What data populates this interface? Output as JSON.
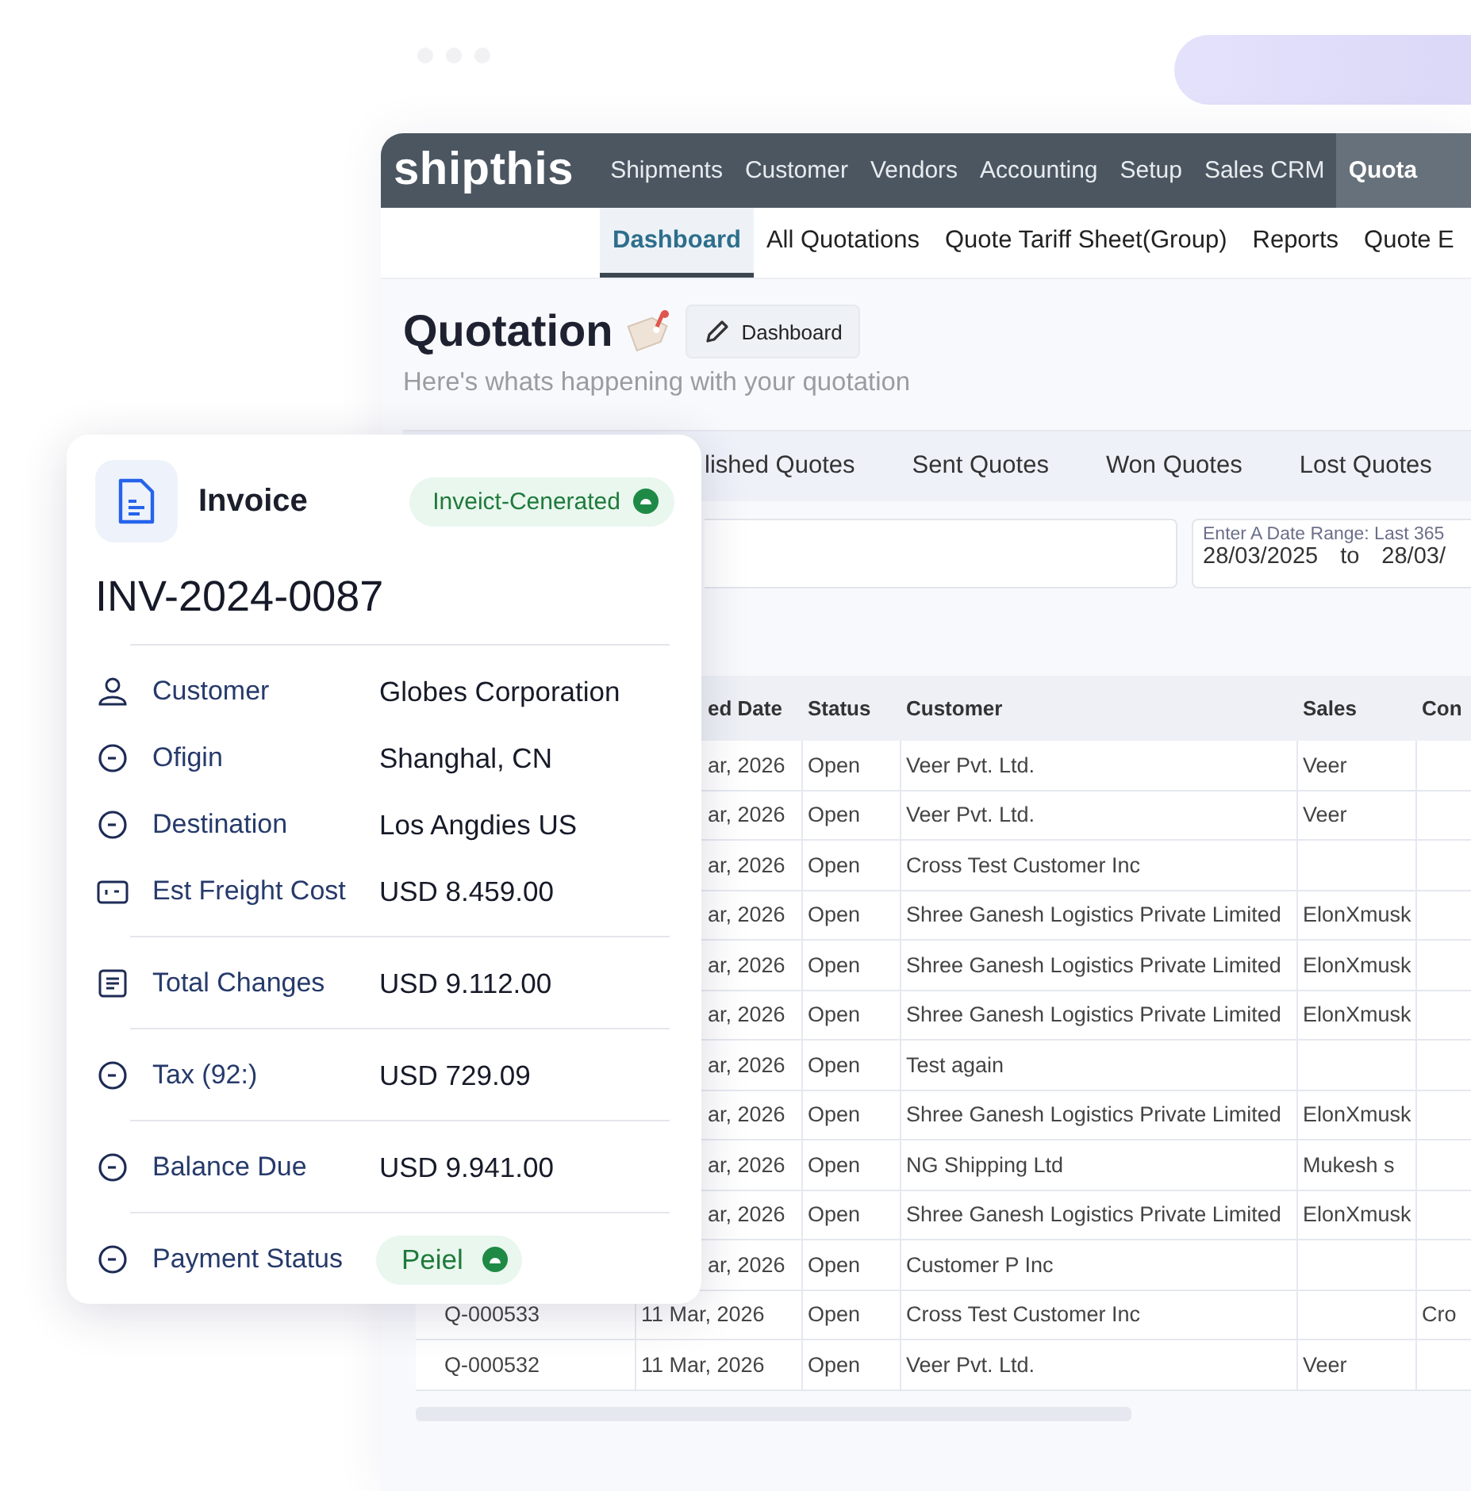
{
  "navbar": {
    "logo": "shipthis",
    "items": [
      {
        "label": "Shipments",
        "selected": false
      },
      {
        "label": "Customer",
        "selected": false
      },
      {
        "label": "Vendors",
        "selected": false
      },
      {
        "label": "Accounting",
        "selected": false
      },
      {
        "label": "Setup",
        "selected": false
      },
      {
        "label": "Sales CRM",
        "selected": false
      },
      {
        "label": "Quota",
        "selected": true
      }
    ]
  },
  "subnav": [
    {
      "label": "Dashboard",
      "selected": true
    },
    {
      "label": "All Quotations",
      "selected": false
    },
    {
      "label": "Quote Tariff Sheet(Group)",
      "selected": false
    },
    {
      "label": "Reports",
      "selected": false
    },
    {
      "label": "Quote E",
      "selected": false
    }
  ],
  "page": {
    "title": "Quotation",
    "button": "Dashboard",
    "subtitle": "Here's whats happening with your quotation"
  },
  "quote_tabs": [
    {
      "label": "lished Quotes",
      "selected": false
    },
    {
      "label": "Sent Quotes",
      "selected": false
    },
    {
      "label": "Won Quotes",
      "selected": false
    },
    {
      "label": "Lost Quotes",
      "selected": false
    }
  ],
  "filters": {
    "date_range": {
      "label": "Enter A Date Range: Last 365",
      "from": "28/03/2025",
      "separator": "to",
      "to": "28/03/"
    }
  },
  "table": {
    "columns": [
      "ed Date",
      "Status",
      "Customer",
      "Sales",
      "Con"
    ],
    "rows": [
      {
        "date": "ar, 2026",
        "status": "Open",
        "customer": "Veer Pvt. Ltd.",
        "sales": "Veer"
      },
      {
        "date": "ar, 2026",
        "status": "Open",
        "customer": "Veer Pvt. Ltd.",
        "sales": "Veer"
      },
      {
        "date": "ar, 2026",
        "status": "Open",
        "customer": "Cross Test Customer Inc"
      },
      {
        "date": "ar, 2026",
        "status": "Open",
        "customer": "Shree Ganesh Logistics Private Limited",
        "sales": "ElonXmusk"
      },
      {
        "date": "ar, 2026",
        "status": "Open",
        "customer": "Shree Ganesh Logistics Private Limited",
        "sales": "ElonXmusk"
      },
      {
        "date": "ar, 2026",
        "status": "Open",
        "customer": "Shree Ganesh Logistics Private Limited",
        "sales": "ElonXmusk"
      },
      {
        "date": "ar, 2026",
        "status": "Open",
        "customer": "Test again"
      },
      {
        "date": "ar, 2026",
        "status": "Open",
        "customer": "Shree Ganesh Logistics Private Limited",
        "sales": "ElonXmusk"
      },
      {
        "date": "ar, 2026",
        "status": "Open",
        "customer": "NG Shipping Ltd",
        "sales": "Mukesh s"
      },
      {
        "date": "ar, 2026",
        "status": "Open",
        "customer": "Shree Ganesh Logistics Private Limited",
        "sales": "ElonXmusk"
      },
      {
        "date": "ar, 2026",
        "status": "Open",
        "customer": "Customer P Inc"
      },
      {
        "id": "Q-000533",
        "date": "11 Mar, 2026",
        "status": "Open",
        "customer": "Cross Test Customer Inc",
        "column_6": "Cro"
      },
      {
        "id": "Q-000532",
        "date": "11 Mar, 2026",
        "status": "Open",
        "customer": "Veer Pvt. Ltd.",
        "sales": "Veer"
      }
    ]
  },
  "invoice_card": {
    "title": "Invoice",
    "status": "Inveict-Cenerated",
    "number": "INV-2024-0087",
    "groups": [
      [
        {
          "kind": "person",
          "label": "Customer",
          "value": "Globes Corporation"
        },
        {
          "kind": "circle",
          "label": "Ofigin",
          "value": "Shanghal, CN"
        },
        {
          "kind": "circle",
          "label": "Destination",
          "value": "Los Angdies US"
        },
        {
          "kind": "card",
          "label": "Est Freight Cost",
          "value": "USD 8.459.00"
        }
      ],
      [
        {
          "kind": "list",
          "label": "Total Changes",
          "value": "USD 9.112.00"
        }
      ],
      [
        {
          "kind": "circle",
          "label": "Tax (92:)",
          "value": "USD 729.09"
        }
      ],
      [
        {
          "kind": "circle",
          "label": "Balance Due",
          "value": "USD 9.941.00"
        }
      ],
      [
        {
          "kind": "circle",
          "label": "Payment Status",
          "badge": "Peiel"
        }
      ]
    ]
  }
}
